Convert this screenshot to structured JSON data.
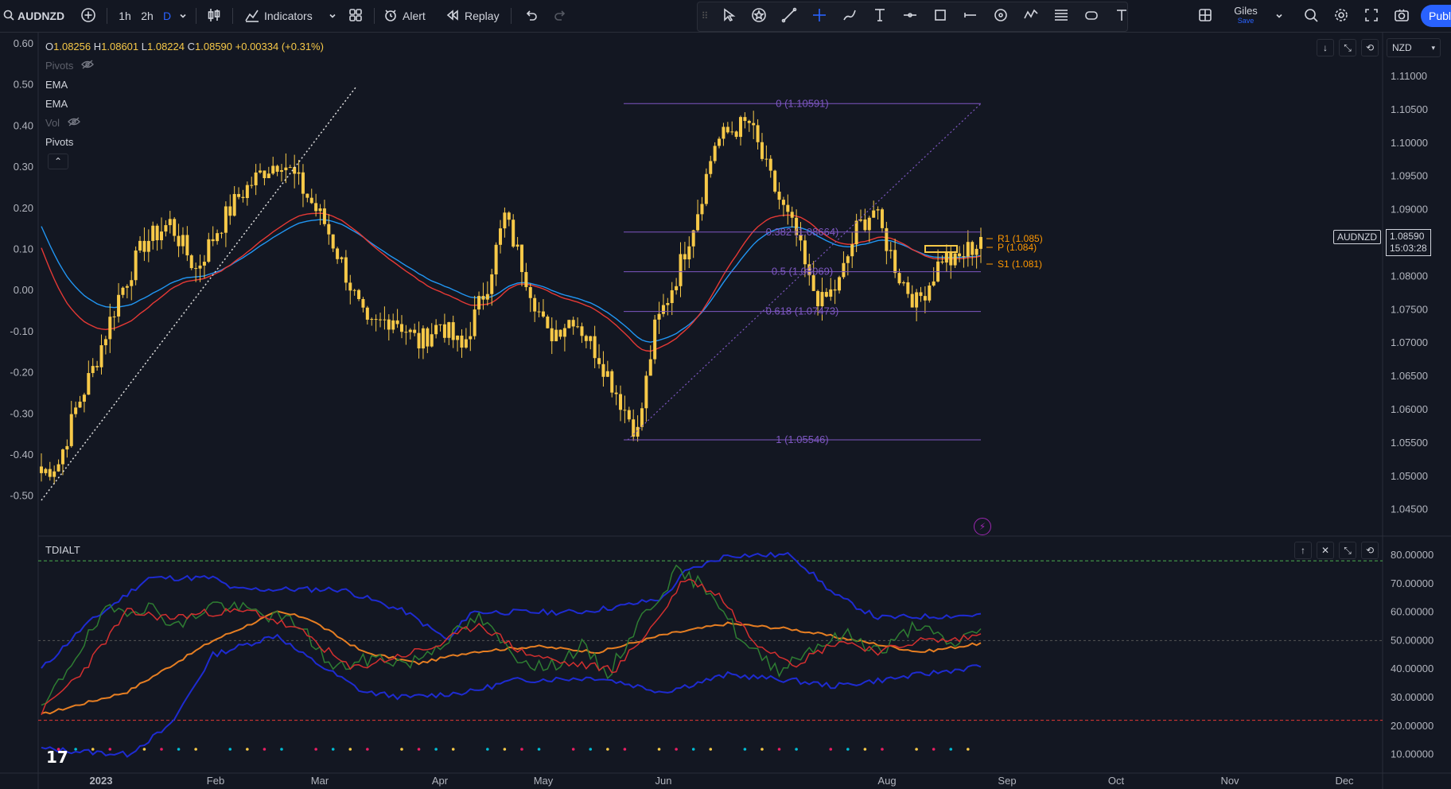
{
  "toolbar": {
    "symbol": "AUDNZD",
    "intervals": [
      "1h",
      "2h",
      "D"
    ],
    "active_interval": "D",
    "indicators_label": "Indicators",
    "alert_label": "Alert",
    "replay_label": "Replay",
    "layout_name": "Giles",
    "layout_status": "Save",
    "publish_label": "Publ"
  },
  "legend": {
    "ohlc": {
      "o_label": "O",
      "o": "1.08256",
      "h_label": "H",
      "h": "1.08601",
      "l_label": "L",
      "l": "1.08224",
      "c_label": "C",
      "c": "1.08590",
      "change": "+0.00334 (+0.31%)"
    },
    "studies": [
      {
        "name": "Pivots",
        "hidden": true
      },
      {
        "name": "EMA",
        "hidden": false
      },
      {
        "name": "EMA",
        "hidden": false
      },
      {
        "name": "Vol",
        "hidden": true
      },
      {
        "name": "Pivots",
        "hidden": false
      }
    ]
  },
  "currency_button": "NZD",
  "price_axis": [
    "1.11000",
    "1.10500",
    "1.10000",
    "1.09500",
    "1.09000",
    "1.08500",
    "1.08000",
    "1.07500",
    "1.07000",
    "1.06500",
    "1.06000",
    "1.05500",
    "1.05000",
    "1.04500"
  ],
  "left_axis": [
    "0.60",
    "0.50",
    "0.40",
    "0.30",
    "0.20",
    "0.10",
    "0.00",
    "-0.10",
    "-0.20",
    "-0.30",
    "-0.40",
    "-0.50"
  ],
  "last_price": {
    "symbol": "AUDNZD",
    "price": "1.08590",
    "countdown": "15:03:28"
  },
  "fib": [
    {
      "label": "0 (1.10591)",
      "price": 1.10591
    },
    {
      "label": "0.382 (1.08664)",
      "price": 1.08664
    },
    {
      "label": "0.5 (1.08069)",
      "price": 1.08069
    },
    {
      "label": "0.618 (1.07473)",
      "price": 1.07473
    },
    {
      "label": "1 (1.05546)",
      "price": 1.05546
    }
  ],
  "pivots": [
    {
      "label": "R1 (1.085)"
    },
    {
      "label": "P (1.084)"
    },
    {
      "label": "S1 (1.081)"
    }
  ],
  "oscillator": {
    "name": "TDIALT",
    "axis": [
      "80.00000",
      "70.00000",
      "60.00000",
      "50.00000",
      "40.00000",
      "30.00000",
      "20.00000",
      "10.00000"
    ],
    "upper_level": 78,
    "mid_level": 50,
    "lower_level": 22
  },
  "time_axis": [
    "2023",
    "Feb",
    "Mar",
    "Apr",
    "May",
    "Jun",
    "Aug",
    "Sep",
    "Oct",
    "Nov",
    "Dec"
  ],
  "colors": {
    "background": "#131722",
    "candle": "#f7c948",
    "ema_fast": "#2196f3",
    "ema_slow": "#e53935",
    "fib": "#7e57c2",
    "pivot": "#ff9800",
    "tdi_green": "#2e7d32",
    "tdi_red": "#d32f2f",
    "tdi_blue": "#1e2bd1",
    "tdi_orange": "#e67e22",
    "accent": "#2962ff"
  }
}
